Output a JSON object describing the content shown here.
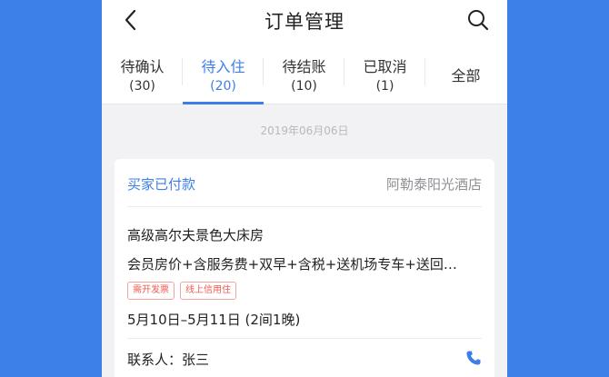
{
  "header": {
    "title": "订单管理",
    "back_icon": "chevron-left-icon",
    "search_icon": "search-icon"
  },
  "tabs": [
    {
      "name": "待确认",
      "count": "(30)",
      "active": false
    },
    {
      "name": "待入住",
      "count": "(20)",
      "active": true
    },
    {
      "name": "待结账",
      "count": "(10)",
      "active": false
    },
    {
      "name": "已取消",
      "count": "(1)",
      "active": false
    },
    {
      "name": "全部",
      "count": "",
      "active": false
    }
  ],
  "date_label": "2019年06月06日",
  "order": {
    "status": "买家已付款",
    "hotel": "阿勒泰阳光酒店",
    "room": "高级高尔夫景色大床房",
    "package": "会员房价+含服务费+双早+含税+送机场专车+送回…",
    "badges": [
      "需开发票",
      "线上信用住"
    ],
    "dates": "5月10日–5月11日 (2间1晚)",
    "contact": "联系人：张三"
  },
  "colors": {
    "accent": "#3d7fe6",
    "background": "#3d80e8",
    "badge": "#ef5a4e"
  }
}
